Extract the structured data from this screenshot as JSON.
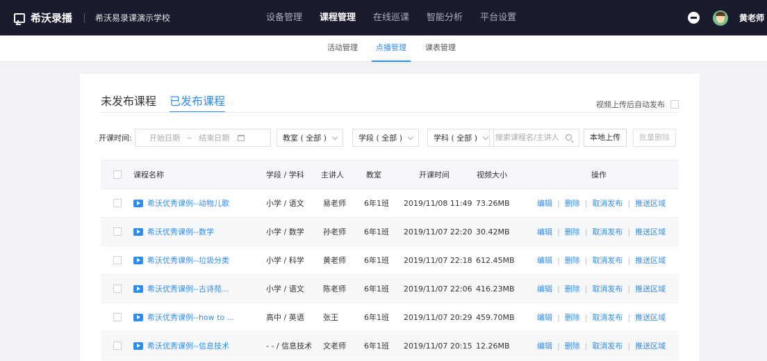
{
  "header": {
    "logo_text": "希沃录播",
    "school_name": "希沃易录课演示学校",
    "nav": [
      {
        "label": "设备管理",
        "active": false
      },
      {
        "label": "课程管理",
        "active": true
      },
      {
        "label": "在线巡课",
        "active": false
      },
      {
        "label": "智能分析",
        "active": false
      },
      {
        "label": "平台设置",
        "active": false
      }
    ],
    "username": "黄老师",
    "colors": {
      "bar": "#1a1b2e",
      "accent": "#2d8cf0"
    }
  },
  "subnav": {
    "items": [
      {
        "label": "活动管理",
        "active": false
      },
      {
        "label": "点播管理",
        "active": true
      },
      {
        "label": "课表管理",
        "active": false
      }
    ]
  },
  "tabs": {
    "unpublished": "未发布课程",
    "published": "已发布课程",
    "active": "已发布课程"
  },
  "auto_publish": {
    "label": "视频上传后自动发布",
    "checked": false
  },
  "filters": {
    "date_label": "开课时间:",
    "start_placeholder": "开始日期",
    "separator": "~",
    "end_placeholder": "结束日期",
    "classroom": "教室 ( 全部 )",
    "stage": "学段 ( 全部 )",
    "subject": "学科 ( 全部 )",
    "search_placeholder": "搜索课程名/主讲人",
    "upload_label": "本地上传",
    "batch_delete_label": "批量删除"
  },
  "table": {
    "columns": {
      "name": "课程名称",
      "stage_subject": "学段 / 学科",
      "teacher": "主讲人",
      "classroom": "教室",
      "time": "开课时间",
      "size": "视频大小",
      "actions": "操作"
    },
    "action_labels": {
      "edit": "编辑",
      "delete": "删除",
      "unpublish": "取消发布",
      "push": "推送区域",
      "sep": "|"
    },
    "rows": [
      {
        "name": "希沃优秀课例--动物儿歌",
        "stage_subject": "小学 / 语文",
        "teacher": "易老师",
        "classroom": "6年1班",
        "time": "2019/11/08 11:49",
        "size": "73.26MB"
      },
      {
        "name": "希沃优秀课例--数学",
        "stage_subject": "小学 / 数学",
        "teacher": "孙老师",
        "classroom": "6年1班",
        "time": "2019/11/07 22:20",
        "size": "30.42MB"
      },
      {
        "name": "希沃优秀课例--垃圾分类",
        "stage_subject": "小学 / 科学",
        "teacher": "黄老师",
        "classroom": "6年1班",
        "time": "2019/11/07 22:18",
        "size": "612.45MB"
      },
      {
        "name": "希沃优秀课例--古诗苑...",
        "stage_subject": "小学 / 语文",
        "teacher": "陈老师",
        "classroom": "6年1班",
        "time": "2019/11/07 22:06",
        "size": "416.23MB"
      },
      {
        "name": "希沃优秀课例--how to ...",
        "stage_subject": "高中 / 英语",
        "teacher": "张王",
        "classroom": "6年1班",
        "time": "2019/11/07 20:29",
        "size": "459.70MB"
      },
      {
        "name": "希沃优秀课例--信息技术",
        "stage_subject": "- - / 信息技术",
        "teacher": "文老师",
        "classroom": "6年1班",
        "time": "2019/11/07 20:15",
        "size": "12.26MB"
      }
    ]
  }
}
